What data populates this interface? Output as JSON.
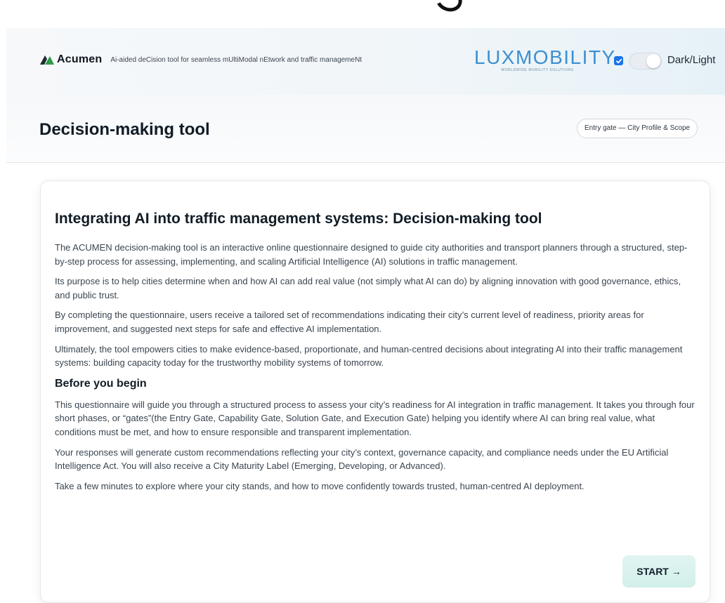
{
  "header": {
    "brand_name": "Acumen",
    "brand_tagline": "Ai-aided deCision tool for seamless mUltiModal nEtwork and traffic managemeNt",
    "partner_logo": {
      "word": "LUXMOBILITY",
      "tagline": "WORLDWIDE MOBILITY SOLUTIONS",
      "color": "#3d8fd0"
    },
    "checkbox_checked": true,
    "theme_toggle_label": "Dark/Light"
  },
  "page": {
    "title": "Decision-making tool",
    "gate_pill": "Entry gate — City Profile & Scope"
  },
  "card": {
    "title": "Integrating AI into traffic management systems: Decision-making tool",
    "intro_paragraphs": [
      "The ACUMEN decision-making tool is an interactive online questionnaire designed to guide city authorities and transport planners through a structured, step-by-step process for assessing, implementing, and scaling Artificial Intelligence (AI) solutions in traffic management.",
      "Its purpose is to help cities determine when and how AI can add real value (not simply what AI can do) by aligning innovation with good governance, ethics, and public trust.",
      "By completing the questionnaire, users receive a tailored set of recommendations indicating their city’s current level of readiness, priority areas for improvement, and suggested next steps for safe and effective AI implementation.",
      "Ultimately, the tool empowers cities to make evidence-based, proportionate, and human-centred decisions about integrating AI into their traffic management systems: building capacity today for the trustworthy mobility systems of tomorrow."
    ],
    "before_title": "Before you begin",
    "before_paragraphs": [
      "This questionnaire will guide you through a structured process to assess your city’s readiness for AI integration in traffic management. It takes you through four short phases, or “gates”(the Entry Gate, Capability Gate, Solution Gate, and Execution Gate) helping you identify where AI can bring real value, what conditions must be met, and how to ensure responsible and transparent implementation.",
      "Your responses will generate custom recommendations reflecting your city’s context, governance capacity, and compliance needs under the EU Artificial Intelligence Act. You will also receive a City Maturity Label (Emerging, Developing, or Advanced).",
      "Take a few minutes to explore where your city stands, and how to move confidently towards trusted, human-centred AI deployment."
    ],
    "start_label": "START →"
  },
  "colors": {
    "accent_green": "#2e9b4a",
    "checkbox_blue": "#1a73e8",
    "start_bg": "#d8f1ec"
  },
  "icons": [
    "acumen-logo-icon",
    "checkmark-icon"
  ]
}
